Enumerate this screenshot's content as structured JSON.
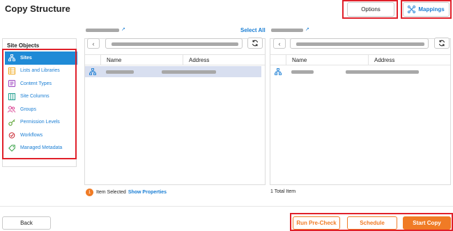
{
  "page": {
    "title": "Copy Structure"
  },
  "header": {
    "options_label": "Options",
    "mappings_label": "Mappings"
  },
  "sidebar": {
    "title": "Site Objects",
    "items": [
      {
        "label": "Sites",
        "icon": "sitemap-icon",
        "active": true
      },
      {
        "label": "Lists and Libraries",
        "icon": "list-icon"
      },
      {
        "label": "Content Types",
        "icon": "content-type-icon"
      },
      {
        "label": "Site Columns",
        "icon": "columns-icon"
      },
      {
        "label": "Groups",
        "icon": "groups-icon"
      },
      {
        "label": "Permission Levels",
        "icon": "key-icon"
      },
      {
        "label": "Workflows",
        "icon": "workflow-icon"
      },
      {
        "label": "Managed Metadata",
        "icon": "tag-icon"
      }
    ]
  },
  "source": {
    "select_all": "Select All",
    "columns": [
      "Name",
      "Address"
    ],
    "status_count": "1",
    "status_text": "Item Selected",
    "status_link": "Show Properties"
  },
  "target": {
    "columns": [
      "Name",
      "Address"
    ],
    "status_text": "1 Total Item"
  },
  "footer": {
    "back_label": "Back",
    "precheck_label": "Run Pre-Check",
    "schedule_label": "Schedule",
    "start_label": "Start Copy"
  },
  "colors": {
    "accent": "#1a7ed4",
    "active": "#1f8ad6",
    "orange": "#f07b25",
    "highlight": "#e0202a"
  }
}
